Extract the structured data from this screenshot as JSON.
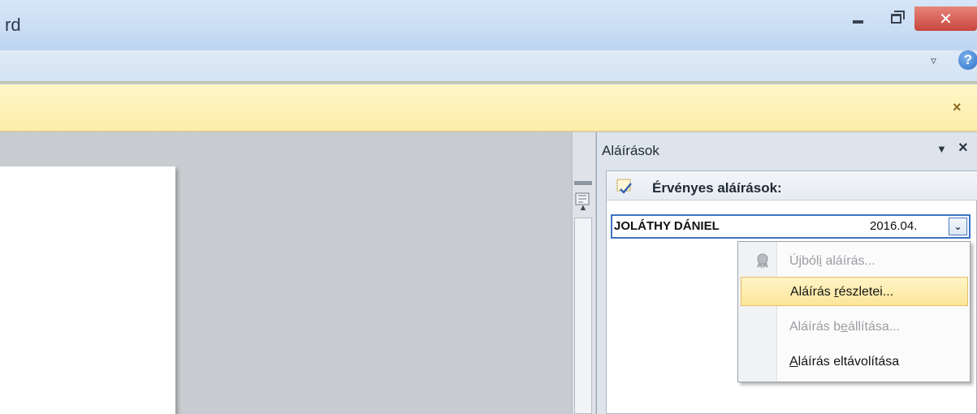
{
  "window": {
    "title_fragment": "rd",
    "close_symbol": "✕",
    "help_symbol": "?"
  },
  "message_bar": {
    "close_symbol": "×"
  },
  "task_pane": {
    "title": "Aláírások",
    "menu_symbol": "▼",
    "close_symbol": "×",
    "section": {
      "title": "Érvényes aláírások:",
      "icon": "valid-signature-icon"
    },
    "signatures": [
      {
        "signer": "JOLÁTHY DÁNIEL",
        "date": "2016.04.",
        "dropdown_symbol": "⌄"
      }
    ]
  },
  "context_menu": {
    "items": [
      {
        "pre": "Újból",
        "accel": "i",
        "post": " aláírás...",
        "enabled": false,
        "icon": "ribbon-badge-icon"
      },
      {
        "pre": "Aláírás ",
        "accel": "r",
        "post": "észletei...",
        "enabled": true,
        "hover": true
      },
      {
        "pre": "Aláírás b",
        "accel": "e",
        "post": "állítása...",
        "enabled": false
      },
      {
        "pre": "",
        "accel": "A",
        "post": "láírás eltávolítása",
        "enabled": true
      }
    ]
  },
  "colors": {
    "accent_blue": "#3f73c4",
    "message_bar": "#fdedaa",
    "close_button": "#c9463c",
    "menu_hover": "#fde69a"
  }
}
